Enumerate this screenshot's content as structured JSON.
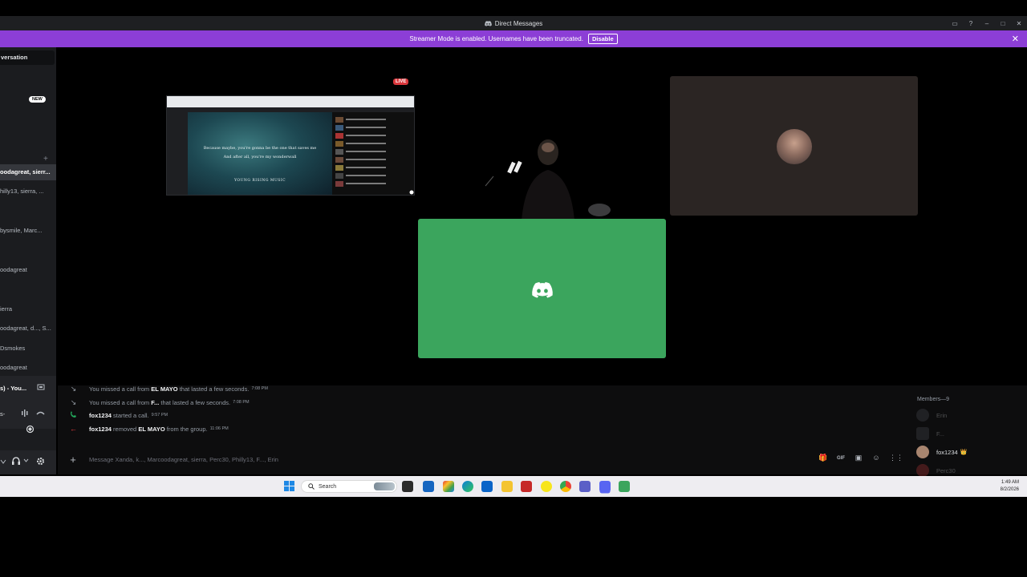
{
  "window": {
    "title": "Direct Messages",
    "controls": [
      "▭",
      "?",
      "–",
      "□",
      "✕"
    ]
  },
  "banner": {
    "text": "Streamer Mode is enabled. Usernames have been truncated.",
    "disable_label": "Disable",
    "close": "✕"
  },
  "sidebar": {
    "search_label": "versation",
    "new_badge": "NEW",
    "plus": "+",
    "dms": [
      "oodagreat, sierr...",
      "hilly13, sierra, ...",
      "bysmile, Marc...",
      "oodagreat",
      "ierra",
      "oodagreat, d..., S...",
      "Dsmokes",
      "oodagreat"
    ],
    "voice_channel": "s) - You...",
    "voice_label": "s-"
  },
  "call": {
    "live_label": "LIVE",
    "lyric_line1": "Because maybe, you're gonna be the one that saves me",
    "lyric_line2": "And after all, you're my wonderwall",
    "lyric_credit": "YOUNG RISING MUSIC"
  },
  "chat": {
    "messages": [
      {
        "icon": "↘",
        "pre": "You missed a call from ",
        "name": "EL MAYO",
        "post": " that lasted a few seconds.",
        "time": "7:08 PM",
        "color": "#949ba4"
      },
      {
        "icon": "↘",
        "pre": "You missed a call from ",
        "name": "F...",
        "post": " that lasted a few seconds.",
        "time": "7:08 PM",
        "color": "#949ba4"
      },
      {
        "icon": "📞",
        "pre": "",
        "name": "fox1234",
        "post": " started a call.",
        "time": "9:57 PM",
        "color": "#23a55a"
      },
      {
        "icon": "←",
        "pre": "",
        "name": "fox1234",
        "post": " removed ",
        "name2": "EL MAYO",
        "post2": " from the group.",
        "time": "11:06 PM",
        "color": "#f23f42"
      }
    ],
    "composer_placeholder": "Message Xanda, k..., Marcoodagreat, sierra, Perc30, Philly13, F..., Erin",
    "composer_plus": "+",
    "tool_icons": [
      "🎁",
      "GIF",
      "▣",
      "☺",
      "⋮⋮"
    ]
  },
  "members": {
    "header": "Members—9",
    "list": [
      {
        "name": "Erin",
        "faded": true
      },
      {
        "name": "F...",
        "faded": true
      },
      {
        "name": "fox1234",
        "faded": false,
        "crown": "👑"
      },
      {
        "name": "Perc30",
        "faded": true
      }
    ]
  },
  "taskbar": {
    "search_label": "Search",
    "time": "1:49 AM",
    "date": "8/2/2026"
  }
}
